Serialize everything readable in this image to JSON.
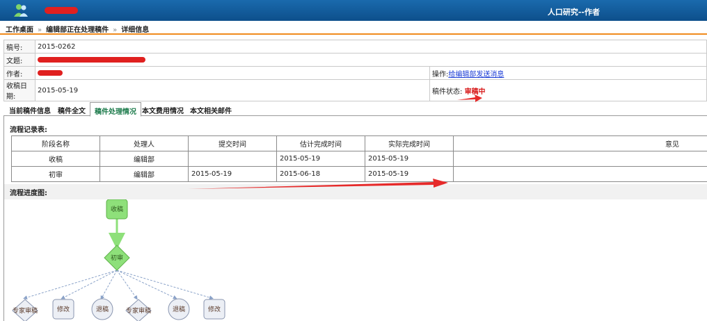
{
  "header": {
    "app_title": "人口研究--作者"
  },
  "breadcrumb": [
    "工作桌面",
    "编辑部正在处理稿件",
    "详细信息"
  ],
  "breadcrumb_sep": "»",
  "info": {
    "id_label": "稿号:",
    "id_value": "2015-0262",
    "title_label": "文题:",
    "author_label": "作者:",
    "action_label": "操作:",
    "action_link": "给编辑部发送消息",
    "date_label": "收稿日期:",
    "date_value": "2015-05-19",
    "status_label": "稿件状态:",
    "status_value": "审稿中"
  },
  "tabs": [
    "当前稿件信息",
    "稿件全文",
    "稿件处理情况",
    "本文费用情况",
    "本文相关邮件"
  ],
  "active_tab": 2,
  "flow_table": {
    "title": "流程记录表:",
    "headers": [
      "阶段名称",
      "处理人",
      "提交时间",
      "估计完成时间",
      "实际完成时间",
      "意见"
    ],
    "rows": [
      [
        "收稿",
        "编辑部",
        "",
        "2015-05-19",
        "2015-05-19",
        ""
      ],
      [
        "初审",
        "编辑部",
        "2015-05-19",
        "2015-06-18",
        "2015-05-19",
        ""
      ]
    ]
  },
  "diagram": {
    "title": "流程进度图:",
    "root": "收稿",
    "decision": "初审",
    "children": [
      "专家审稿",
      "修改",
      "退稿",
      "专家审稿",
      "退稿",
      "修改"
    ]
  },
  "colors": {
    "header_bg": "#0d4f8b",
    "accent_orange": "#f08a1c",
    "status_red": "#d81a1a",
    "active_tab_text": "#1b7a4a",
    "node_green": "#8ee07a"
  }
}
